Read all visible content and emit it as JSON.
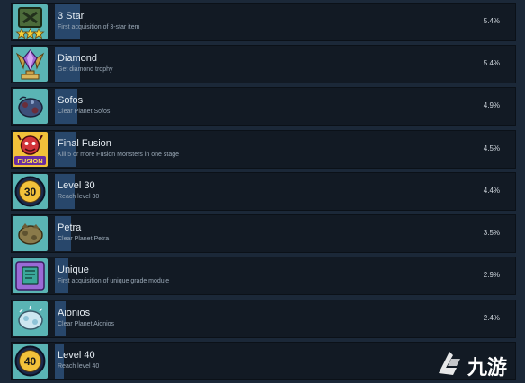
{
  "rows": [
    {
      "title": "3 Star",
      "desc": "First acquisition of 3-star item",
      "percent": "5.4%",
      "progress": 0.054,
      "icon": "three-star-chest-icon"
    },
    {
      "title": "Diamond",
      "desc": "Get diamond trophy",
      "percent": "5.4%",
      "progress": 0.054,
      "icon": "diamond-trophy-icon"
    },
    {
      "title": "Sofos",
      "desc": "Clear Planet Sofos",
      "percent": "4.9%",
      "progress": 0.049,
      "icon": "planet-sofos-icon"
    },
    {
      "title": "Final Fusion",
      "desc": "Kill 5 or more Fusion Monsters in one stage",
      "percent": "4.5%",
      "progress": 0.045,
      "icon": "fusion-monster-icon"
    },
    {
      "title": "Level 30",
      "desc": "Reach level 30",
      "percent": "4.4%",
      "progress": 0.044,
      "icon": "level-30-badge-icon"
    },
    {
      "title": "Petra",
      "desc": "Clear Planet Petra",
      "percent": "3.5%",
      "progress": 0.035,
      "icon": "planet-petra-icon"
    },
    {
      "title": "Unique",
      "desc": "First acquisition of unique grade module",
      "percent": "2.9%",
      "progress": 0.029,
      "icon": "unique-module-icon"
    },
    {
      "title": "Aionios",
      "desc": "Clear Planet Aionios",
      "percent": "2.4%",
      "progress": 0.024,
      "icon": "planet-aionios-icon"
    },
    {
      "title": "Level 40",
      "desc": "Reach level 40",
      "percent": "",
      "progress": 0.02,
      "icon": "level-40-badge-icon"
    }
  ],
  "badges": {
    "level30": "30",
    "level40": "40",
    "fusion": "FUSION"
  },
  "watermark": {
    "text": "九游",
    "icon": "jiuyou-logo-icon"
  },
  "colors": {
    "background": "#1b2838",
    "row": "#121a24",
    "bar": "#2a4a70"
  }
}
